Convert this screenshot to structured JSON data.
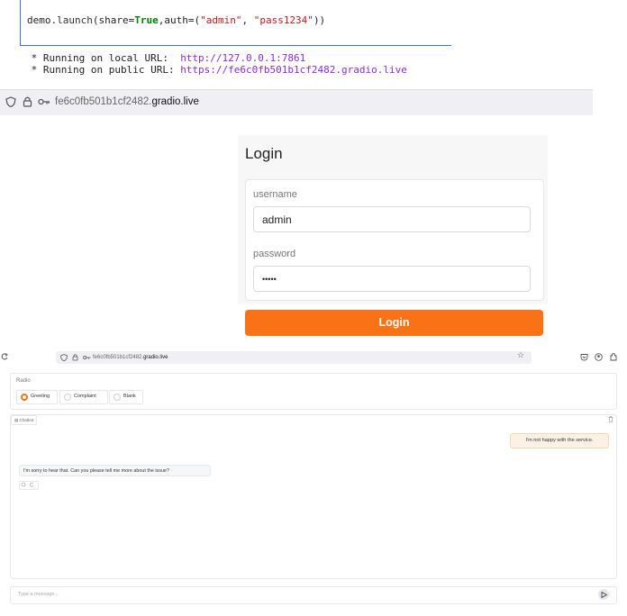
{
  "notebook": {
    "code": {
      "prefix": "demo.",
      "fn": "launch",
      "share_kw": "(share=",
      "share_val": "True",
      "auth_kw": ",auth=(",
      "user": "\"admin\"",
      "sep": ", ",
      "pass": "\"pass1234\"",
      "suffix": "))"
    },
    "output": {
      "local_label": " * Running on local URL:  ",
      "local_url": "http://127.0.0.1:7861",
      "public_label": " * Running on public URL: ",
      "public_url": "https://fe6c0fb501b1cf2482.gradio.live"
    }
  },
  "browser1": {
    "url_prefix": "fe6c0fb501b1cf2482.",
    "url_domain": "gradio.live"
  },
  "login": {
    "title": "Login",
    "username_label": "username",
    "username_value": "admin",
    "password_label": "password",
    "password_value": "•••••",
    "button_label": "Login"
  },
  "browser2": {
    "url_prefix": "fe6c0fb501b1cf2482.",
    "url_domain": "gradio.live"
  },
  "app": {
    "radio": {
      "label": "Radio",
      "options": [
        "Greeting",
        "Complaint",
        "Blank"
      ],
      "selected": "Greeting"
    },
    "chatbot": {
      "label": "Chatbot",
      "messages": [
        {
          "role": "user",
          "text": "I'm not happy with the service."
        },
        {
          "role": "bot",
          "text": "I'm sorry to hear that. Can you please tell me more about the issue?"
        }
      ]
    },
    "input": {
      "placeholder": "Type a message..."
    }
  },
  "colors": {
    "accent": "#f97316",
    "link": "#8a2be2",
    "cell_border": "#3b6fd8"
  }
}
